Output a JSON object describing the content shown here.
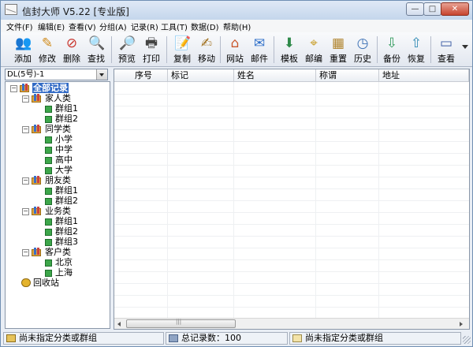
{
  "window": {
    "title": "信封大师 V5.22 [专业版]"
  },
  "title_buttons": {
    "minimize": "—",
    "maximize": "□",
    "close": "✕"
  },
  "menu": [
    "文件(F)",
    "编辑(E)",
    "查看(V)",
    "分组(A)",
    "记录(R)",
    "工具(T)",
    "数据(D)",
    "帮助(H)"
  ],
  "toolbar": [
    {
      "label": "添加",
      "icon": "add-contact-icon",
      "glyph": "👥",
      "color": "#3a8a3a"
    },
    {
      "label": "修改",
      "icon": "edit-pencil-icon",
      "glyph": "✎",
      "color": "#d08a1a"
    },
    {
      "label": "删除",
      "icon": "delete-icon",
      "glyph": "⊘",
      "color": "#c9362e"
    },
    {
      "label": "查找",
      "icon": "search-icon",
      "glyph": "🔍",
      "color": "#555555"
    },
    {
      "label": "预览",
      "icon": "preview-icon",
      "glyph": "🔎",
      "color": "#3a6fb4"
    },
    {
      "label": "打印",
      "icon": "printer-icon",
      "glyph": "🖶",
      "color": "#444444"
    },
    {
      "label": "复制",
      "icon": "copy-icon",
      "glyph": "📝",
      "color": "#b07a2a"
    },
    {
      "label": "移动",
      "icon": "move-icon",
      "glyph": "✍",
      "color": "#a0701e"
    },
    {
      "label": "网站",
      "icon": "website-home-icon",
      "glyph": "⌂",
      "color": "#c9582e"
    },
    {
      "label": "邮件",
      "icon": "mail-icon",
      "glyph": "✉",
      "color": "#2e6fc9"
    },
    {
      "label": "模板",
      "icon": "template-icon",
      "glyph": "⬇",
      "color": "#2f8a4a"
    },
    {
      "label": "邮编",
      "icon": "postcode-icon",
      "glyph": "⌖",
      "color": "#c9a02e"
    },
    {
      "label": "重置",
      "icon": "reset-grid-icon",
      "glyph": "▦",
      "color": "#b0842e"
    },
    {
      "label": "历史",
      "icon": "history-clock-icon",
      "glyph": "◷",
      "color": "#3a6fb4"
    },
    {
      "label": "备份",
      "icon": "backup-icon",
      "glyph": "⇩",
      "color": "#2f9a5a"
    },
    {
      "label": "恢复",
      "icon": "restore-icon",
      "glyph": "⇧",
      "color": "#2f8ab4"
    },
    {
      "label": "查看",
      "icon": "view-monitor-icon",
      "glyph": "▭",
      "color": "#3a5aa4"
    }
  ],
  "combo": {
    "value": "DL(5号)-1"
  },
  "tree": {
    "root": "全部记录",
    "categories": [
      {
        "name": "家人类",
        "children": [
          "群组1",
          "群组2"
        ]
      },
      {
        "name": "同学类",
        "children": [
          "小学",
          "中学",
          "高中",
          "大学"
        ]
      },
      {
        "name": "朋友类",
        "children": [
          "群组1",
          "群组2"
        ]
      },
      {
        "name": "业务类",
        "children": [
          "群组1",
          "群组2",
          "群组3"
        ]
      },
      {
        "name": "客户类",
        "children": [
          "北京",
          "上海"
        ]
      }
    ],
    "recycle": "回收站"
  },
  "list": {
    "columns": [
      "序号",
      "标记",
      "姓名",
      "称谓",
      "地址"
    ]
  },
  "status": {
    "left": "尚未指定分类或群组",
    "middle": "总记录数：100",
    "right": "尚未指定分类或群组"
  }
}
